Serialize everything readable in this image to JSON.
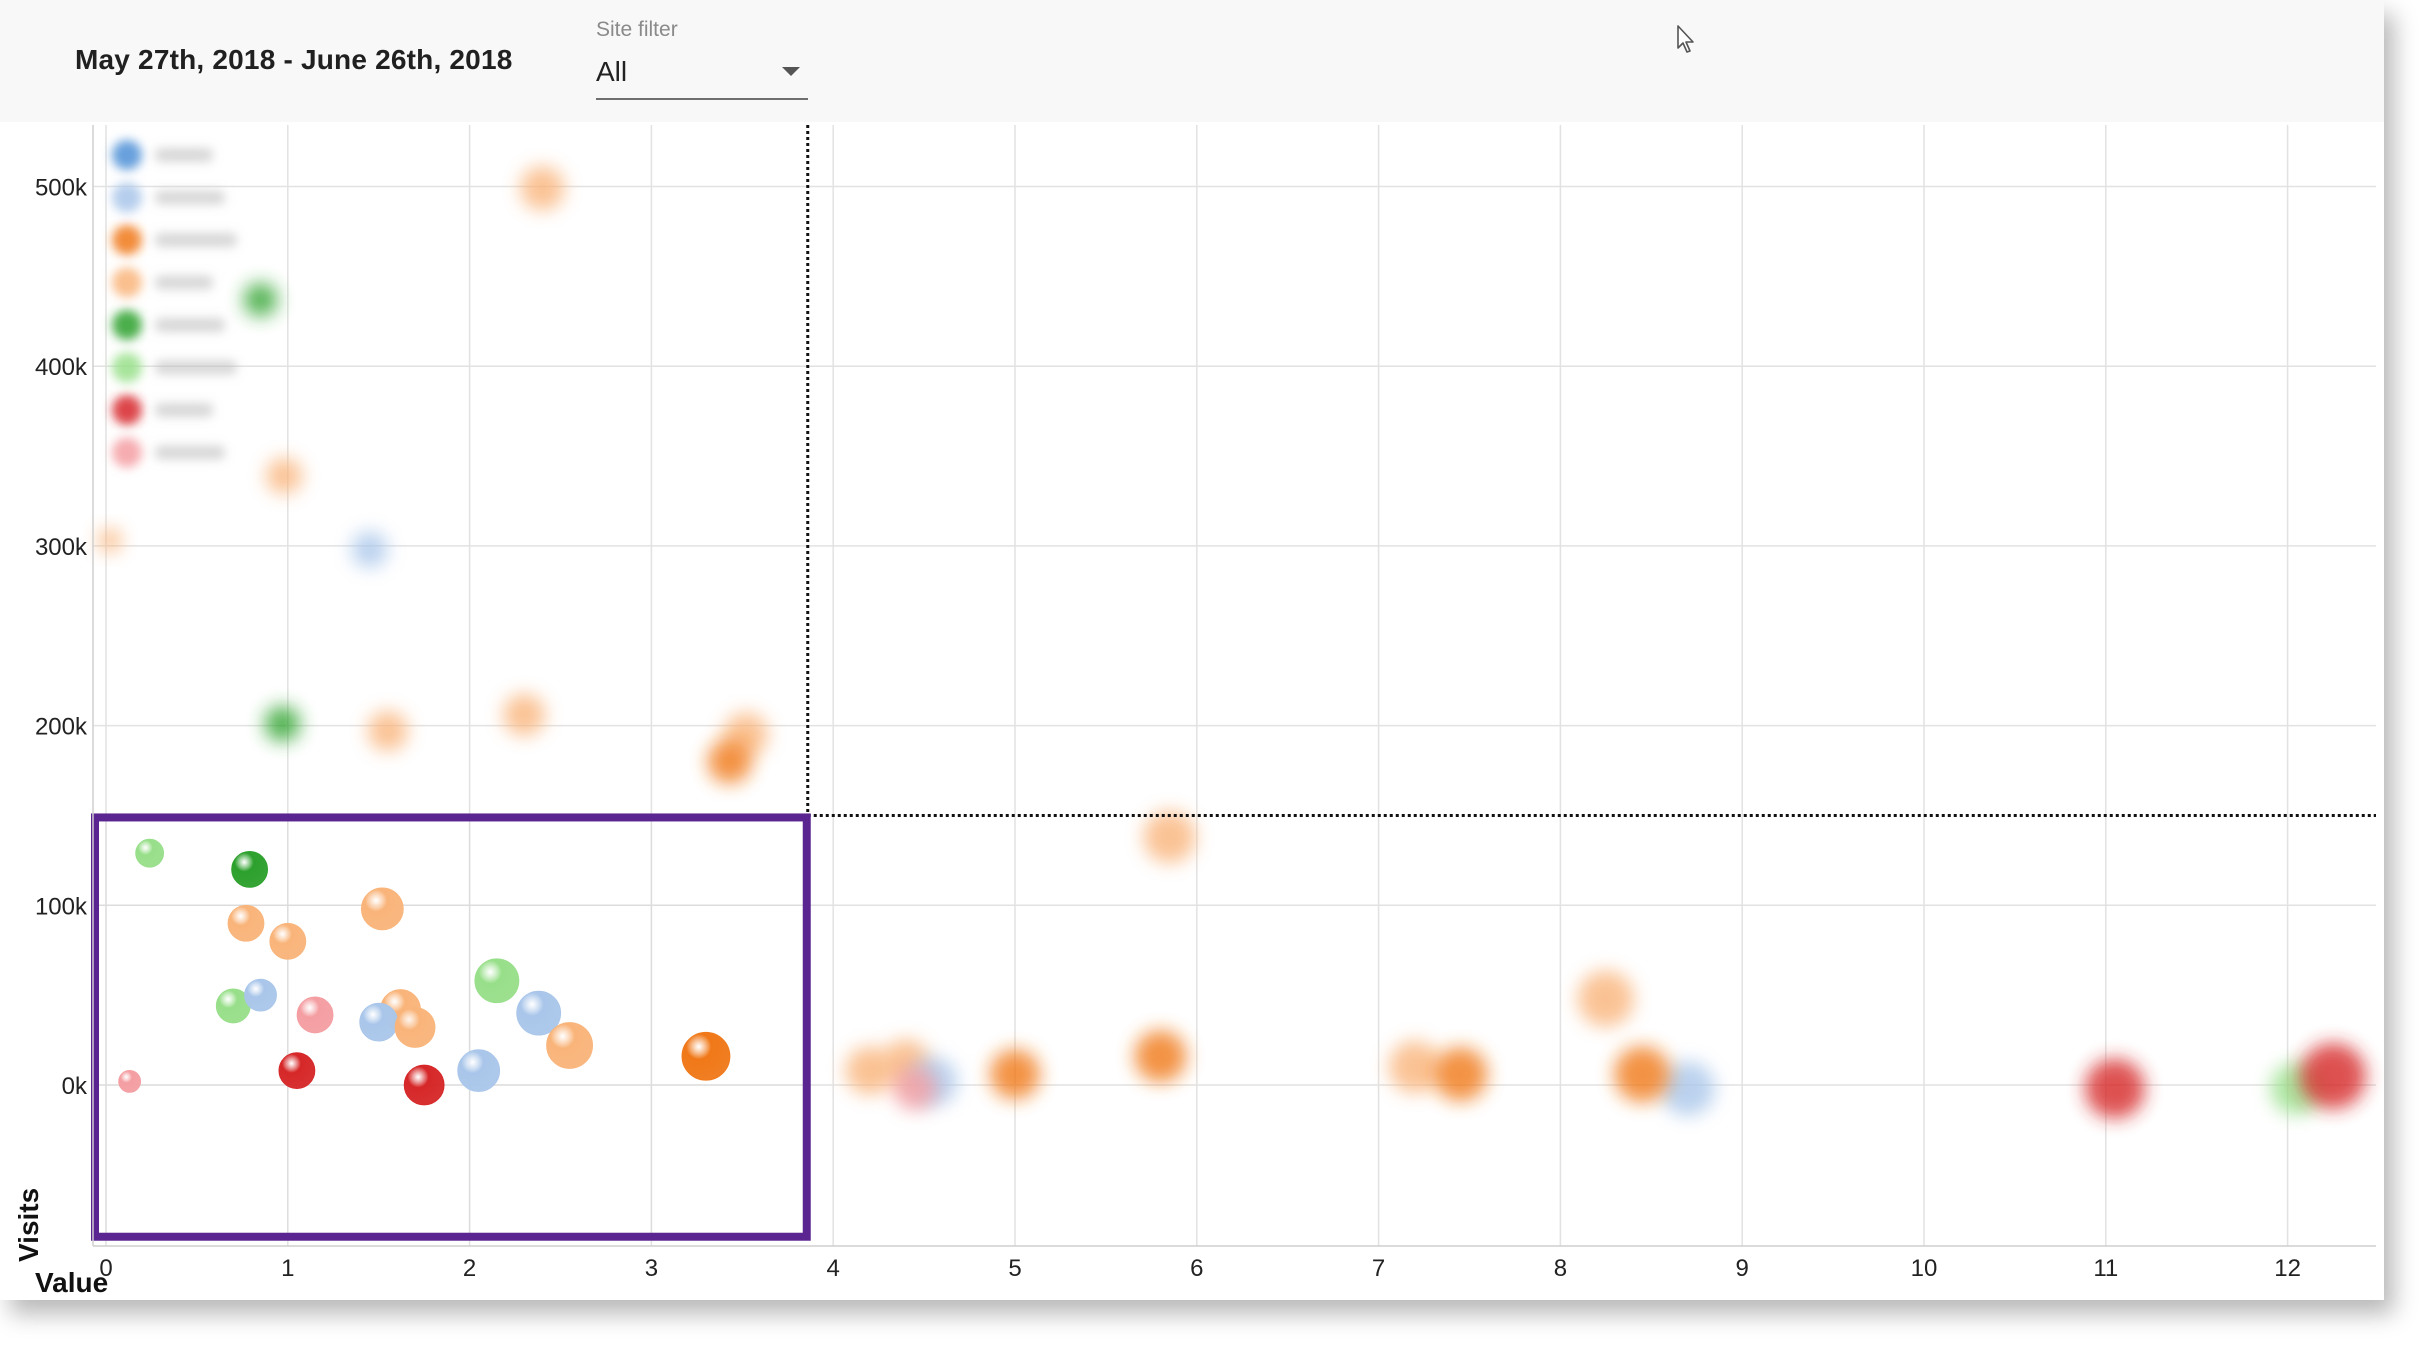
{
  "header": {
    "date_range": "May 27th, 2018 - June 26th, 2018",
    "filter_label": "Site filter",
    "filter_value": "All"
  },
  "chart_data": {
    "type": "scatter",
    "xlabel": "Value",
    "ylabel": "Visits",
    "xlim": [
      0,
      12.5
    ],
    "ylim": [
      -90000,
      530000
    ],
    "x_ticks": [
      0,
      1,
      2,
      3,
      4,
      5,
      6,
      7,
      8,
      9,
      10,
      11,
      12
    ],
    "y_ticks": [
      0,
      100000,
      200000,
      300000,
      400000,
      500000
    ],
    "y_tick_labels": [
      "0k",
      "100k",
      "200k",
      "300k",
      "400k",
      "500k"
    ],
    "grid": true,
    "threshold_x": 3.86,
    "threshold_y": 150000,
    "highlight_region": {
      "x": [
        0,
        3.86
      ],
      "y": [
        -90000,
        150000
      ]
    },
    "legend": {
      "position": "top-left",
      "blurred": true
    },
    "palette": {
      "dark_blue": "#4e8fd6",
      "light_blue": "#a9c6ea",
      "dark_orange": "#f07818",
      "light_orange": "#f9b47a",
      "dark_green": "#2ca02c",
      "light_green": "#98df8a",
      "dark_red": "#d62728",
      "light_red": "#f49ea2",
      "highlight": "#5a2590"
    },
    "points": [
      {
        "x": 0.24,
        "y": 129000,
        "r": 14,
        "color": "light_green"
      },
      {
        "x": 0.79,
        "y": 120000,
        "r": 18,
        "color": "dark_green"
      },
      {
        "x": 1.52,
        "y": 98000,
        "r": 21,
        "color": "light_orange"
      },
      {
        "x": 0.77,
        "y": 90000,
        "r": 18,
        "color": "light_orange"
      },
      {
        "x": 1.0,
        "y": 80000,
        "r": 18,
        "color": "light_orange"
      },
      {
        "x": 2.15,
        "y": 58000,
        "r": 22,
        "color": "light_green"
      },
      {
        "x": 0.7,
        "y": 44000,
        "r": 17,
        "color": "light_green"
      },
      {
        "x": 0.85,
        "y": 50000,
        "r": 16,
        "color": "light_blue"
      },
      {
        "x": 1.15,
        "y": 39000,
        "r": 18,
        "color": "light_red"
      },
      {
        "x": 1.62,
        "y": 42000,
        "r": 20,
        "color": "light_orange"
      },
      {
        "x": 1.5,
        "y": 35000,
        "r": 19,
        "color": "light_blue"
      },
      {
        "x": 1.7,
        "y": 32000,
        "r": 20,
        "color": "light_orange"
      },
      {
        "x": 2.38,
        "y": 40000,
        "r": 22,
        "color": "light_blue"
      },
      {
        "x": 2.55,
        "y": 22000,
        "r": 23,
        "color": "light_orange"
      },
      {
        "x": 3.3,
        "y": 16000,
        "r": 24,
        "color": "dark_orange"
      },
      {
        "x": 0.13,
        "y": 2000,
        "r": 11,
        "color": "light_red"
      },
      {
        "x": 1.05,
        "y": 8000,
        "r": 18,
        "color": "dark_red"
      },
      {
        "x": 2.05,
        "y": 8000,
        "r": 21,
        "color": "light_blue"
      },
      {
        "x": 1.75,
        "y": 0,
        "r": 20,
        "color": "dark_red"
      },
      {
        "x": 0.85,
        "y": 437000,
        "r": 17,
        "color": "dark_green",
        "blurred": true
      },
      {
        "x": 2.4,
        "y": 499000,
        "r": 22,
        "color": "light_orange",
        "blurred": true
      },
      {
        "x": 0.98,
        "y": 339000,
        "r": 18,
        "color": "light_orange",
        "blurred": true
      },
      {
        "x": 1.45,
        "y": 298000,
        "r": 18,
        "color": "light_blue",
        "blurred": true
      },
      {
        "x": 0.02,
        "y": 303000,
        "r": 12,
        "color": "light_orange",
        "blurred": true
      },
      {
        "x": 0.97,
        "y": 201000,
        "r": 18,
        "color": "dark_green",
        "blurred": true
      },
      {
        "x": 1.55,
        "y": 197000,
        "r": 20,
        "color": "light_orange",
        "blurred": true
      },
      {
        "x": 2.3,
        "y": 206000,
        "r": 21,
        "color": "light_orange",
        "blurred": true
      },
      {
        "x": 3.52,
        "y": 195000,
        "r": 22,
        "color": "light_orange",
        "blurred": true
      },
      {
        "x": 3.43,
        "y": 180000,
        "r": 22,
        "color": "dark_orange",
        "blurred": true
      },
      {
        "x": 5.85,
        "y": 138000,
        "r": 26,
        "color": "light_orange",
        "blurred": true
      },
      {
        "x": 8.25,
        "y": 48000,
        "r": 28,
        "color": "light_orange",
        "blurred": true
      },
      {
        "x": 5.8,
        "y": 16000,
        "r": 26,
        "color": "dark_orange",
        "blurred": true
      },
      {
        "x": 4.2,
        "y": 8000,
        "r": 24,
        "color": "light_orange",
        "blurred": true
      },
      {
        "x": 4.4,
        "y": 12000,
        "r": 24,
        "color": "light_orange",
        "blurred": true
      },
      {
        "x": 4.55,
        "y": 2000,
        "r": 24,
        "color": "light_blue",
        "blurred": true
      },
      {
        "x": 4.45,
        "y": -2000,
        "r": 22,
        "color": "light_red",
        "blurred": true
      },
      {
        "x": 5.0,
        "y": 6000,
        "r": 25,
        "color": "dark_orange",
        "blurred": true
      },
      {
        "x": 7.2,
        "y": 10000,
        "r": 26,
        "color": "light_orange",
        "blurred": true
      },
      {
        "x": 7.45,
        "y": 6000,
        "r": 27,
        "color": "dark_orange",
        "blurred": true
      },
      {
        "x": 8.7,
        "y": -2000,
        "r": 27,
        "color": "light_blue",
        "blurred": true
      },
      {
        "x": 8.45,
        "y": 6000,
        "r": 28,
        "color": "dark_orange",
        "blurred": true
      },
      {
        "x": 11.05,
        "y": -2000,
        "r": 30,
        "color": "dark_red",
        "blurred": true
      },
      {
        "x": 12.05,
        "y": -2000,
        "r": 26,
        "color": "light_green",
        "blurred": true
      },
      {
        "x": 12.25,
        "y": 5000,
        "r": 33,
        "color": "dark_red",
        "blurred": true
      }
    ]
  }
}
